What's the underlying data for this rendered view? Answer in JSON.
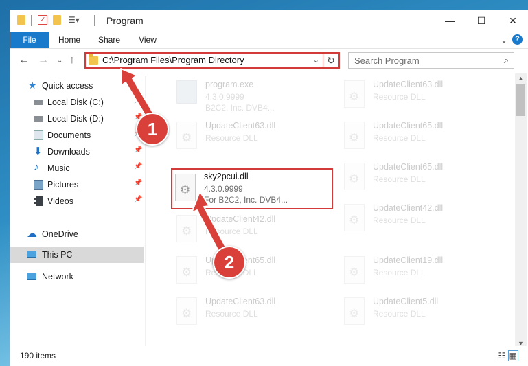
{
  "window": {
    "title": "Program",
    "controls": {
      "minimize": "—",
      "maximize": "☐",
      "close": "✕"
    }
  },
  "ribbon": {
    "tabs": [
      "File",
      "Home",
      "Share",
      "View"
    ],
    "help": "?"
  },
  "address_bar": {
    "path": "C:\\Program Files\\Program Directory"
  },
  "search": {
    "placeholder": "Search Program"
  },
  "sidebar": {
    "items": [
      {
        "label": "Quick access",
        "icon": "star-icon"
      },
      {
        "label": "Local Disk (C:)",
        "icon": "drive-icon",
        "pinned": true
      },
      {
        "label": "Local Disk (D:)",
        "icon": "drive-icon",
        "pinned": true
      },
      {
        "label": "Documents",
        "icon": "documents-icon",
        "pinned": true
      },
      {
        "label": "Downloads",
        "icon": "downloads-icon",
        "pinned": true
      },
      {
        "label": "Music",
        "icon": "music-icon",
        "pinned": true
      },
      {
        "label": "Pictures",
        "icon": "pictures-icon",
        "pinned": true
      },
      {
        "label": "Videos",
        "icon": "videos-icon",
        "pinned": true
      },
      {
        "label": "OneDrive",
        "icon": "onedrive-icon"
      },
      {
        "label": "This PC",
        "icon": "computer-icon",
        "selected": true
      },
      {
        "label": "Network",
        "icon": "network-icon"
      }
    ]
  },
  "files": [
    {
      "name": "program.exe",
      "line2": "4.3.0.9999",
      "line3": "B2C2, Inc. DVB4..."
    },
    {
      "name": "UpdateClient63.dll",
      "line2": "Resource DLL"
    },
    {
      "name": "UpdateClient63.dll",
      "line2": "Resource DLL"
    },
    {
      "name": "UpdateClient65.dll",
      "line2": "Resource DLL"
    },
    {
      "name": "sky2pcui.dll",
      "line2": "4.3.0.9999",
      "line3": "For B2C2, Inc. DVB4..."
    },
    {
      "name": "UpdateClient65.dll",
      "line2": "Resource DLL"
    },
    {
      "name": "UpdateClient42.dll",
      "line2": "Resource DLL"
    },
    {
      "name": "UpdateClient42.dll",
      "line2": "Resource DLL"
    },
    {
      "name": "UpdateClient65.dll",
      "line2": "Resource DLL"
    },
    {
      "name": "UpdateClient19.dll",
      "line2": "Resource DLL"
    },
    {
      "name": "UpdateClient63.dll",
      "line2": "Resource DLL"
    },
    {
      "name": "UpdateClient5.dll",
      "line2": "Resource DLL"
    }
  ],
  "status": {
    "item_count": "190 items"
  },
  "annotations": {
    "step1": "1",
    "step2": "2"
  },
  "colors": {
    "accent": "#1979ca",
    "highlight": "#d33a3a",
    "badge": "#d9403a"
  }
}
